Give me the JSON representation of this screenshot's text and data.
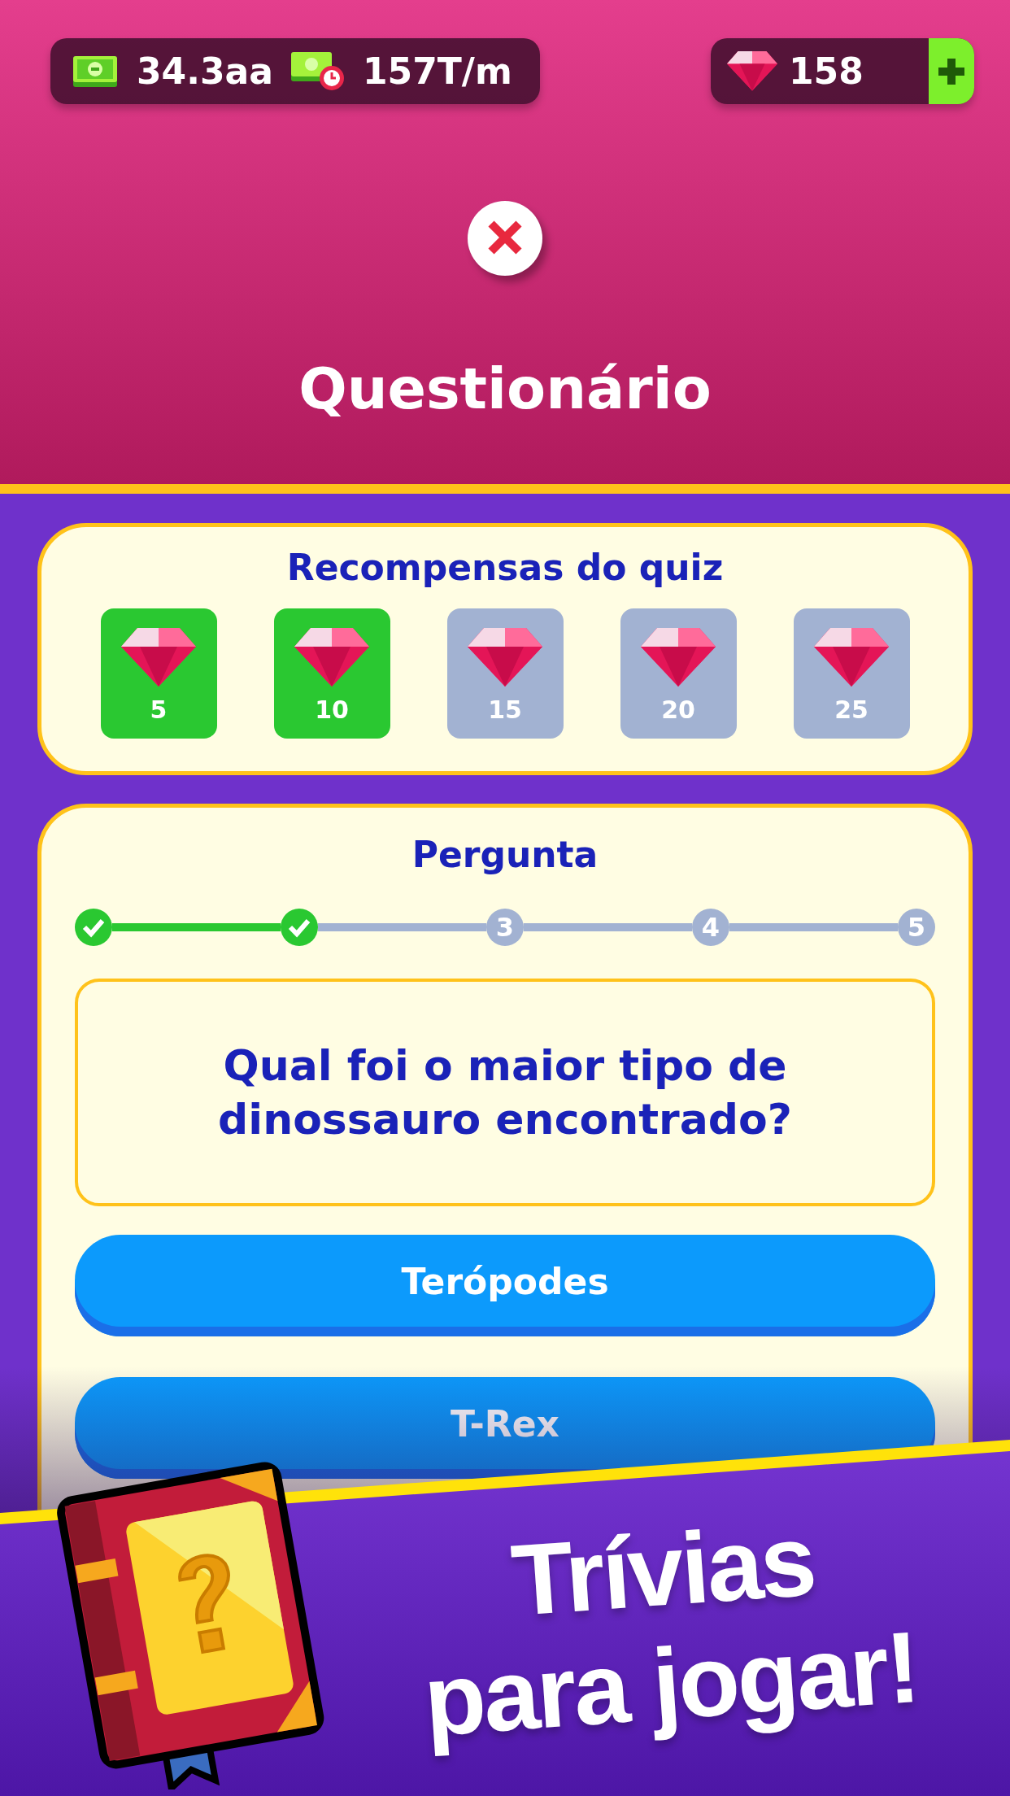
{
  "hud": {
    "cash": "34.3aa",
    "income": "157T/m",
    "gems": "158"
  },
  "title": "Questionário",
  "rewards": {
    "title": "Recompensas do quiz",
    "items": [
      {
        "amount": "5",
        "claimed": true
      },
      {
        "amount": "10",
        "claimed": true
      },
      {
        "amount": "15",
        "claimed": false
      },
      {
        "amount": "20",
        "claimed": false
      },
      {
        "amount": "25",
        "claimed": false
      }
    ]
  },
  "question": {
    "heading": "Pergunta",
    "steps": [
      {
        "done": true
      },
      {
        "done": true
      },
      {
        "label": "3",
        "done": false
      },
      {
        "label": "4",
        "done": false
      },
      {
        "label": "5",
        "done": false
      }
    ],
    "text": "Qual foi o maior tipo de dinossauro encontrado?",
    "answers": [
      "Terópodes",
      "T-Rex"
    ]
  },
  "promo": {
    "line_1": "Trívias",
    "line_2": "para jogar!"
  }
}
